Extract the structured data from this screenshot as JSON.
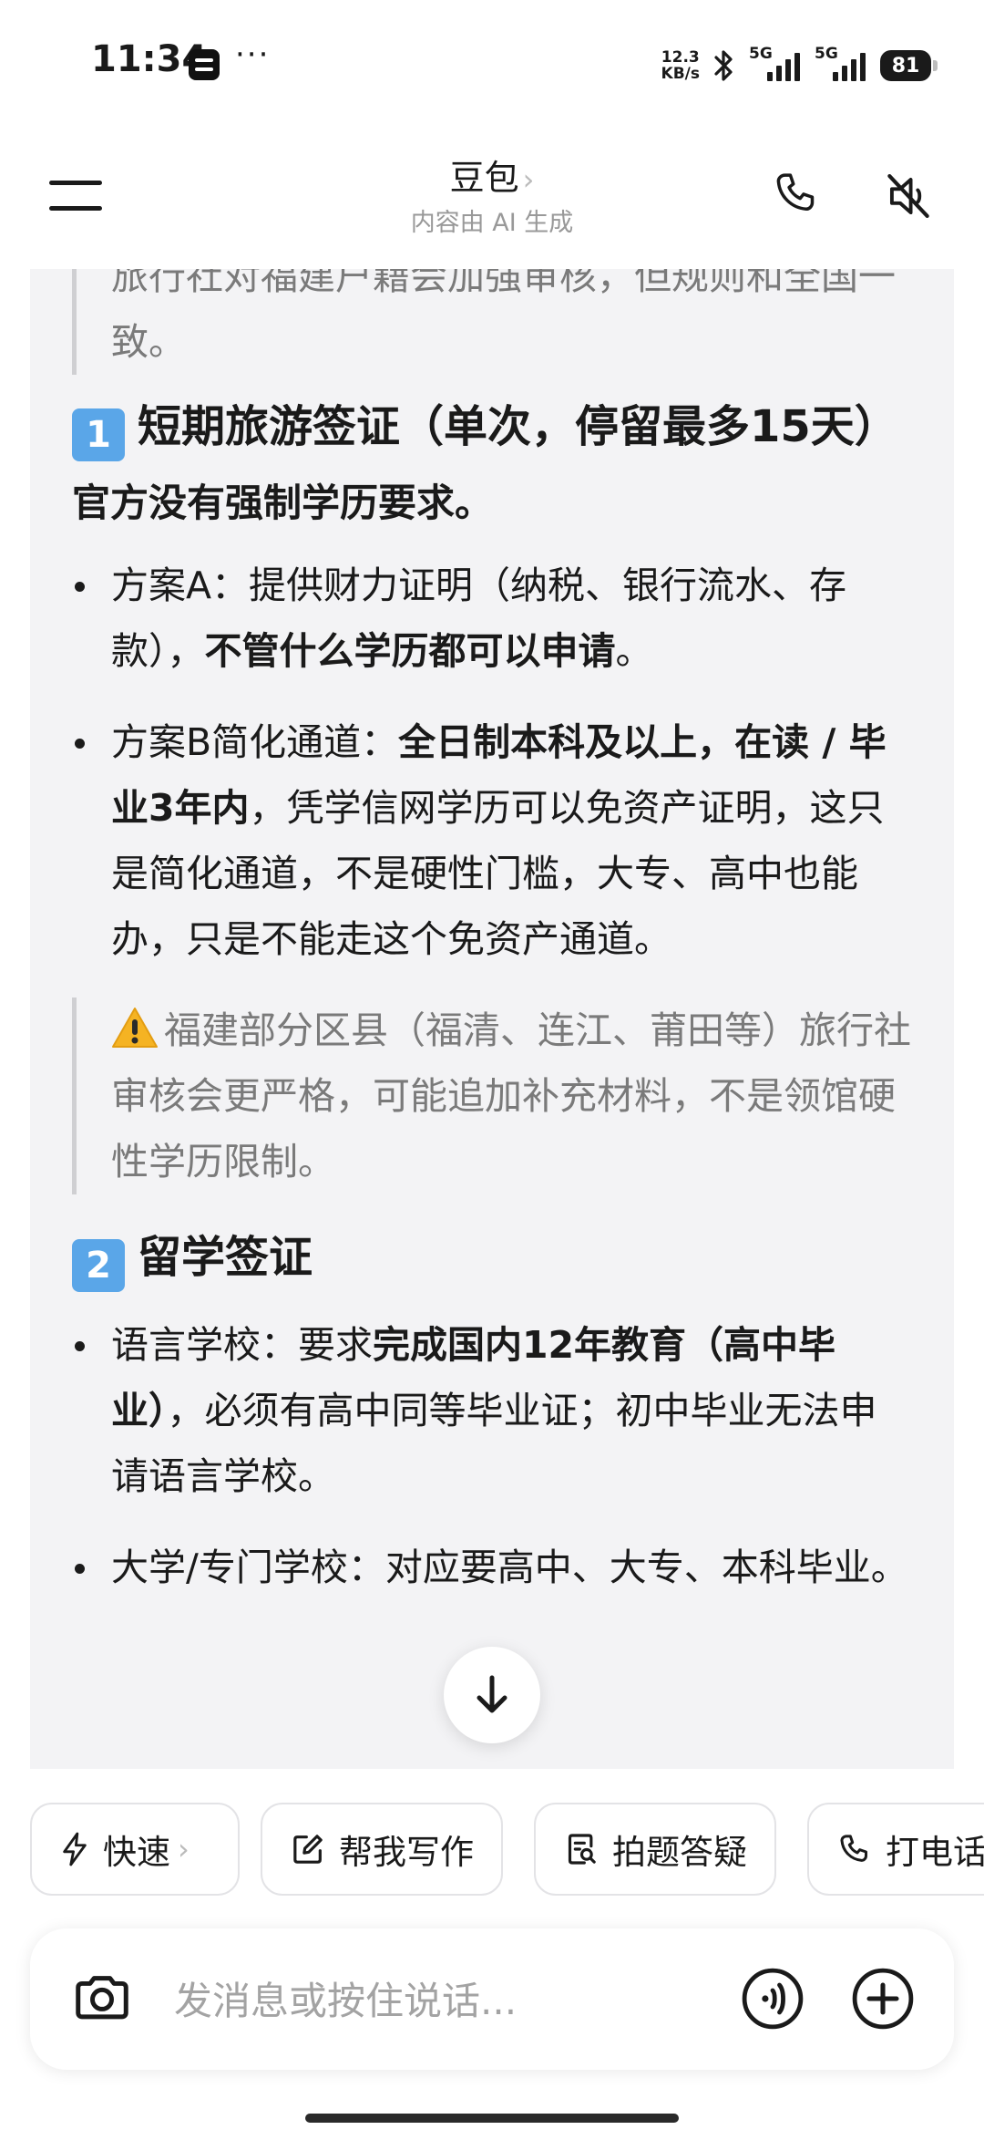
{
  "status_bar": {
    "time": "11:34",
    "dots": "···",
    "net_speed_value": "12.3",
    "net_speed_unit": "KB/s",
    "signal_1_label": "5G",
    "signal_2_label": "5G",
    "battery_level": "81"
  },
  "header": {
    "title": "豆包",
    "title_chevron": "›",
    "subtitle": "内容由 AI 生成"
  },
  "content": {
    "quote_top": "旅行社对福建户籍会加强审核，但规则和全国一致。",
    "section1": {
      "number": "1",
      "heading": "短期旅游签证（单次，停留最多15天）",
      "intro": "官方没有强制学历要求。",
      "bullet_a_text": "方案A：提供财力证明（纳税、银行流水、存款），",
      "bullet_a_bold": "不管什么学历都可以申请",
      "bullet_a_end": "。",
      "bullet_b_text": "方案B简化通道：",
      "bullet_b_bold": "全日制本科及以上，在读 / 毕业3年内",
      "bullet_b_end": "，凭学信网学历可以免资产证明，这只是简化通道，不是硬性门槛，大专、高中也能办，只是不能走这个免资产通道。",
      "warning": "福建部分区县（福清、连江、莆田等）旅行社审核会更严格，可能追加补充材料，不是领馆硬性学历限制。"
    },
    "section2": {
      "number": "2",
      "heading": "留学签证",
      "bullet_a_text": "语言学校：要求",
      "bullet_a_bold": "完成国内12年教育（高中毕业）",
      "bullet_a_end": "，必须有高中同等毕业证；初中毕业无法申请语言学校。",
      "bullet_b_text": "大学/专门学校：对应要高中、大专、本科毕业。"
    }
  },
  "quick_actions": {
    "fast": "快速",
    "fast_chevron": "›",
    "write": "帮我写作",
    "photo_qa": "拍题答疑",
    "call": "打电话"
  },
  "input": {
    "placeholder": "发消息或按住说话..."
  }
}
